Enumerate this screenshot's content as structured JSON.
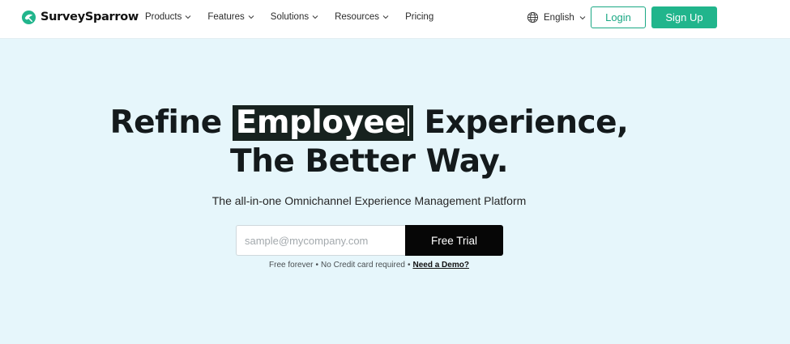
{
  "brand": {
    "name": "SurveySparrow",
    "accent_color": "#21b58c",
    "logo_icon": "sparrow-logo-icon"
  },
  "nav": {
    "items": [
      {
        "label": "Products",
        "has_dropdown": true
      },
      {
        "label": "Features",
        "has_dropdown": true
      },
      {
        "label": "Solutions",
        "has_dropdown": true
      },
      {
        "label": "Resources",
        "has_dropdown": true
      },
      {
        "label": "Pricing",
        "has_dropdown": false
      }
    ],
    "language": {
      "label": "English",
      "icon": "globe-icon"
    },
    "login_label": "Login",
    "signup_label": "Sign Up"
  },
  "hero": {
    "prefix": "Refine",
    "highlighted_word": "Employee",
    "suffix": "Experience,",
    "line2": "The Better Way.",
    "subtitle": "The all-in-one Omnichannel Experience Management Platform"
  },
  "signup_form": {
    "email_placeholder": "sample@mycompany.com",
    "email_value": "",
    "button_label": "Free Trial"
  },
  "fineprint": {
    "part1": "Free forever",
    "part2": "No Credit card required",
    "separator": "•",
    "demo_link": "Need a Demo?"
  },
  "colors": {
    "hero_background": "#e6f6fb",
    "highlight_background": "#17221f",
    "cta_background": "#060606"
  }
}
